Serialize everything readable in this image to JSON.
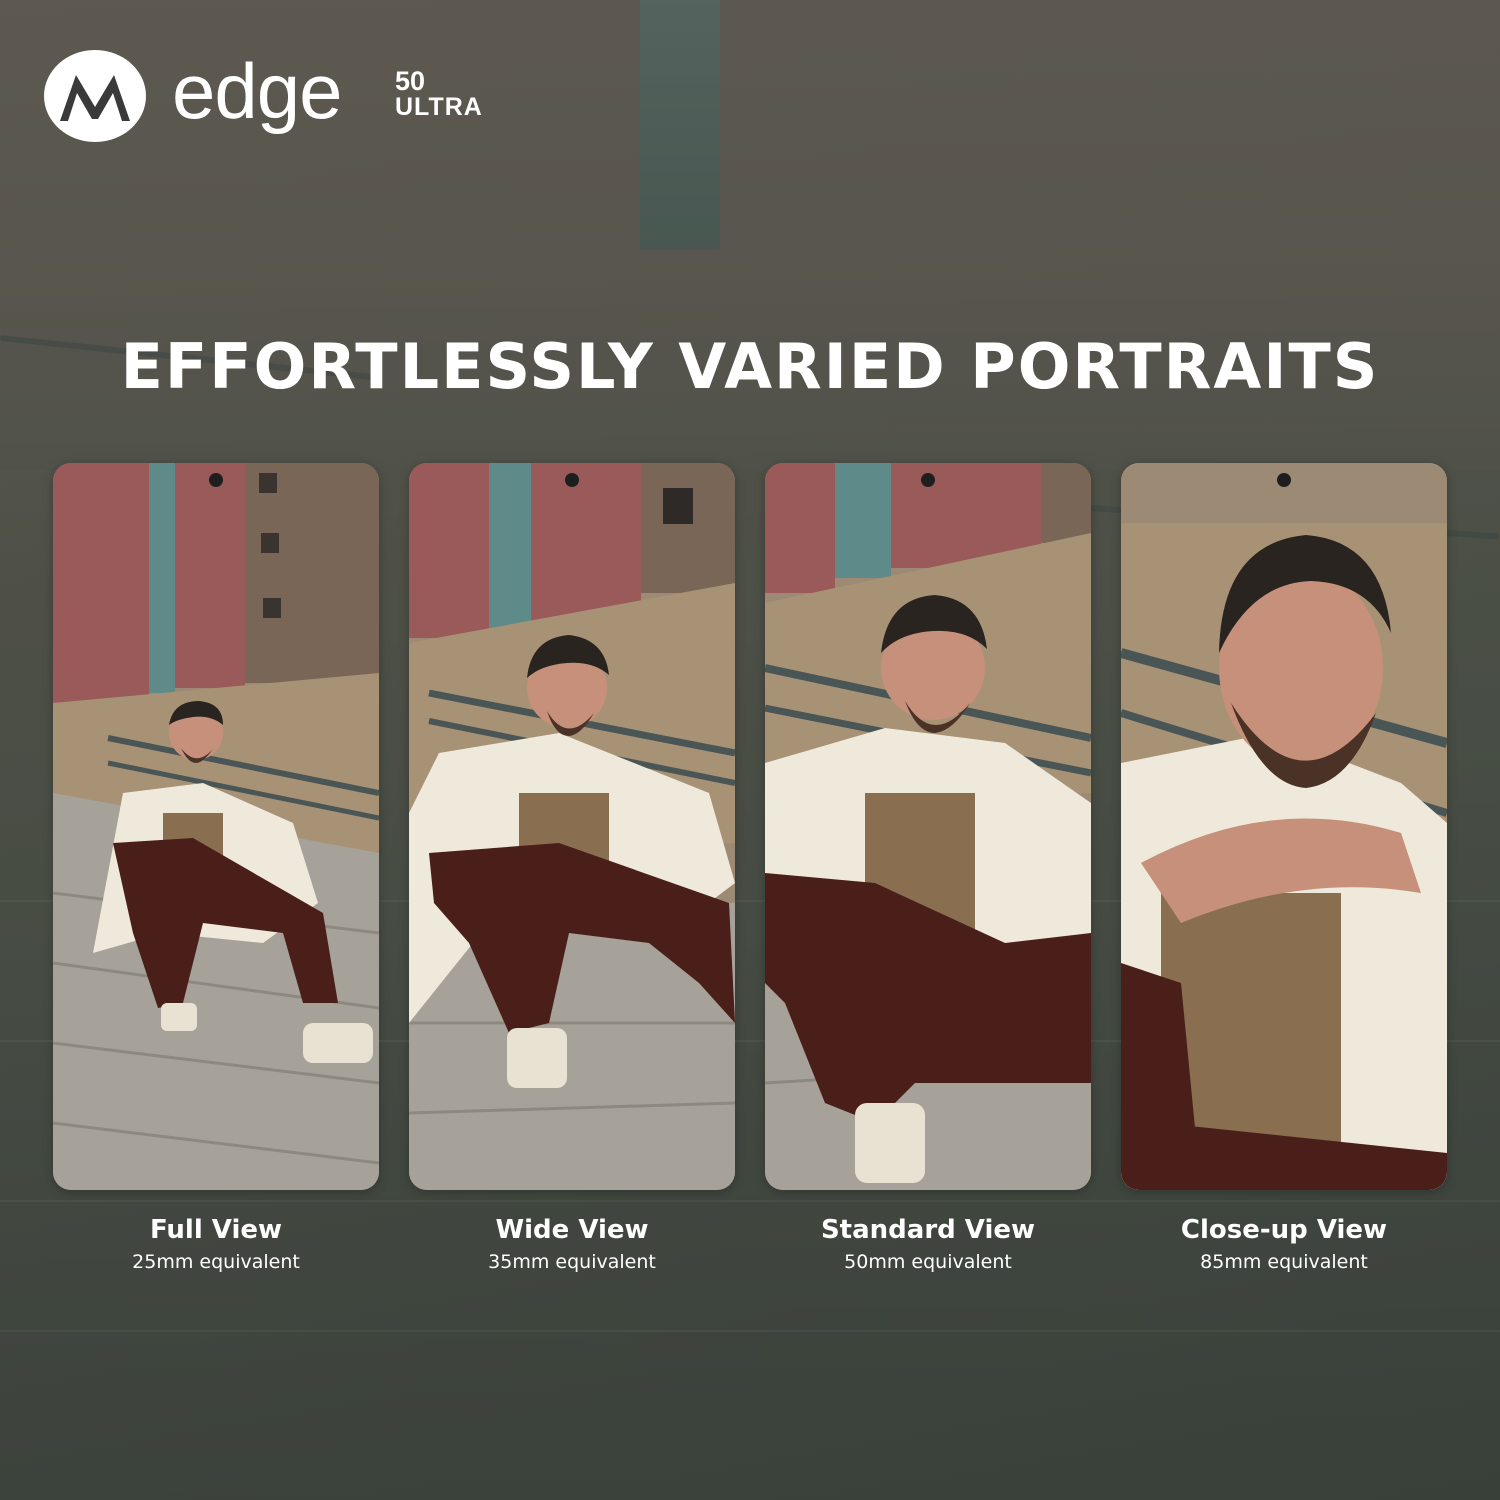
{
  "brand": {
    "logo_icon": "motorola-batwing-logo",
    "product_name": "edge",
    "model_number": "50",
    "model_suffix": "ULTRA"
  },
  "headline": "EFFORTLESSLY VARIED PORTRAITS",
  "views": [
    {
      "title": "Full View",
      "subtitle": "25mm equivalent"
    },
    {
      "title": "Wide View",
      "subtitle": "35mm equivalent"
    },
    {
      "title": "Standard View",
      "subtitle": "50mm equivalent"
    },
    {
      "title": "Close-up View",
      "subtitle": "85mm equivalent"
    }
  ],
  "colors": {
    "background": "#4d5249",
    "text": "#ffffff",
    "brick": "#9a5a5a",
    "stone": "#a08a70",
    "jacket": "#efe9dc",
    "trousers": "#4a1f1a",
    "shirt": "#8a6e50"
  }
}
